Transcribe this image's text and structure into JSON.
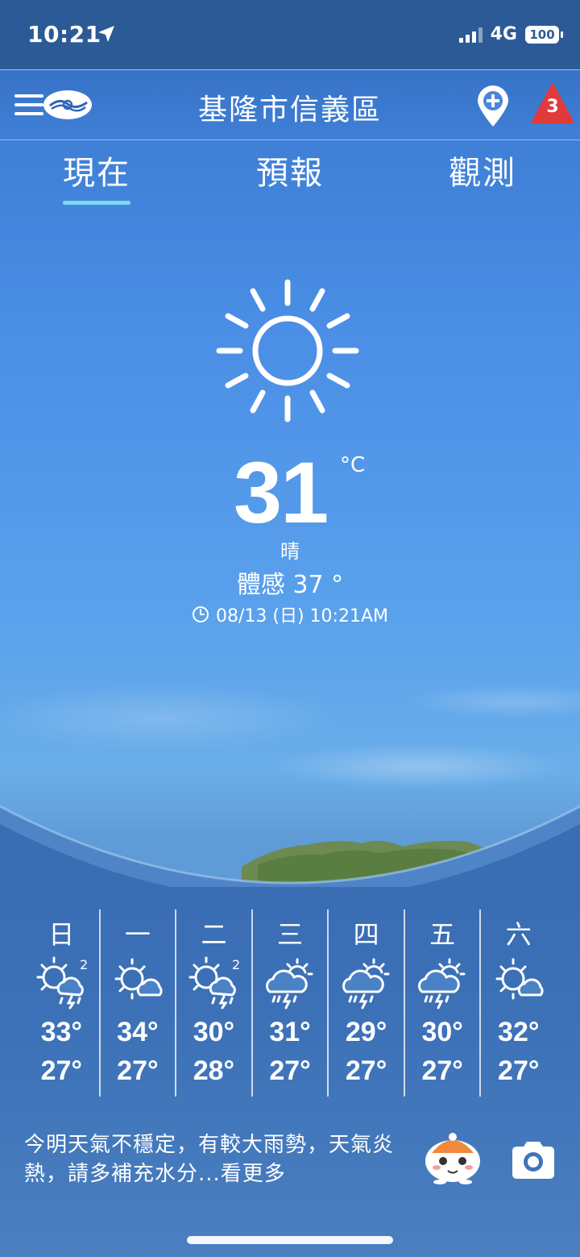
{
  "status_bar": {
    "time": "10:21",
    "network": "4G",
    "battery": "100"
  },
  "header": {
    "location": "基隆市信義區",
    "warning_count": "3"
  },
  "tabs": [
    {
      "label": "現在",
      "active": true
    },
    {
      "label": "預報",
      "active": false
    },
    {
      "label": "觀測",
      "active": false
    }
  ],
  "current": {
    "icon": "sunny-icon",
    "temperature": "31",
    "unit": "°C",
    "condition": "晴",
    "feels_like": "體感 37 °",
    "observed_at": "08/13 (日) 10:21AM"
  },
  "week": [
    {
      "day": "日",
      "icon": "sun-cloud-thunder-icon",
      "high": "33°",
      "low": "27°"
    },
    {
      "day": "一",
      "icon": "sun-cloud-icon",
      "high": "34°",
      "low": "27°"
    },
    {
      "day": "二",
      "icon": "sun-cloud-thunder-icon",
      "high": "30°",
      "low": "28°"
    },
    {
      "day": "三",
      "icon": "cloud-sun-thunder-icon",
      "high": "31°",
      "low": "27°"
    },
    {
      "day": "四",
      "icon": "cloud-sun-thunder-icon",
      "high": "29°",
      "low": "27°"
    },
    {
      "day": "五",
      "icon": "cloud-sun-thunder-icon",
      "high": "30°",
      "low": "27°"
    },
    {
      "day": "六",
      "icon": "sun-cloud-icon",
      "high": "32°",
      "low": "27°"
    }
  ],
  "summary": "今明天氣不穩定，有較大雨勢，天氣炎熱，請多補充水分...看更多",
  "colors": {
    "accent_underline": "#7fd6ef",
    "warning": "#e03a3a",
    "status_bar": "#2c5a97"
  }
}
